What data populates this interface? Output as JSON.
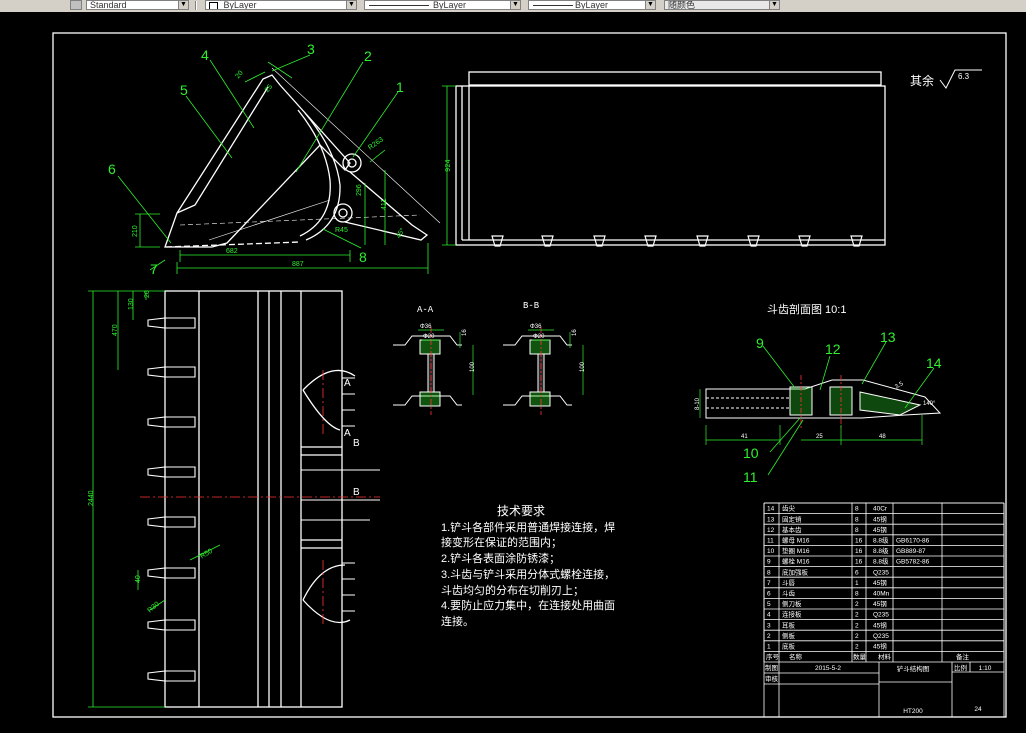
{
  "toolbar": {
    "textstyle": "Standard",
    "layer": "ByLayer",
    "linetype": "ByLayer",
    "lineweight": "ByLayer",
    "plotstyle": "随颜色"
  },
  "drawing": {
    "roughness_prefix": "其余",
    "roughness_value": "6.3",
    "section_detail_title": "斗齿剖面图 10:1",
    "section_aa": "A-A",
    "section_bb": "B-B",
    "leaders": [
      "1",
      "2",
      "3",
      "4",
      "5",
      "6",
      "7",
      "8",
      "9",
      "10",
      "11",
      "12",
      "13",
      "14"
    ],
    "dims_side": {
      "d1": "887",
      "d2": "682",
      "d3": "210",
      "d4": "924",
      "d5": "411",
      "d6": "296",
      "d7": "R45",
      "d8": "R263",
      "d9": "20",
      "d10": "45°",
      "d11": "25"
    },
    "dims_plan": {
      "overall": "2440",
      "a": "470",
      "b": "130",
      "c": "20",
      "d": "40",
      "e": "R50",
      "f": "R30"
    },
    "dims_section": {
      "a": "Φ36",
      "b": "Φ20",
      "c": "16",
      "d": "100"
    },
    "dims_tooth": {
      "a": "41",
      "b": "25",
      "c": "48",
      "d": "8-10",
      "e": "140°",
      "f": "3.5"
    },
    "section_arrows": [
      "A",
      "A",
      "B",
      "B"
    ]
  },
  "tech": {
    "title": "技术要求",
    "lines": [
      "1.铲斗各部件采用普通焊接连接，焊",
      "接变形在保证的范围内；",
      "2.铲斗各表面涂防锈漆；",
      "3.斗齿与铲斗采用分体式螺栓连接，",
      "斗齿均匀的分布在切削刃上；",
      "4.要防止应力集中，在连接处用曲面",
      "连接。"
    ]
  },
  "bom": {
    "rows": [
      [
        "14",
        "齿尖",
        "8",
        "40Cr",
        ""
      ],
      [
        "13",
        "固定销",
        "8",
        "45钢",
        ""
      ],
      [
        "12",
        "基本齿",
        "8",
        "45钢",
        ""
      ],
      [
        "11",
        "螺母 M16",
        "16",
        "8.8级",
        "GB6170-86"
      ],
      [
        "10",
        "垫圈 M16",
        "16",
        "8.8级",
        "GB889-87"
      ],
      [
        "9",
        "螺栓 M16",
        "16",
        "8.8级",
        "GB5782-86"
      ],
      [
        "8",
        "底加强板",
        "6",
        "Q235",
        ""
      ],
      [
        "7",
        "斗唇",
        "1",
        "45钢",
        ""
      ],
      [
        "6",
        "斗齿",
        "8",
        "40Mn",
        ""
      ],
      [
        "5",
        "侧刀板",
        "2",
        "45钢",
        ""
      ],
      [
        "4",
        "连接板",
        "2",
        "Q235",
        ""
      ],
      [
        "3",
        "耳板",
        "2",
        "45钢",
        ""
      ],
      [
        "2",
        "侧板",
        "2",
        "Q235",
        ""
      ],
      [
        "1",
        "底板",
        "2",
        "45钢",
        ""
      ]
    ],
    "header": [
      "序号",
      "名称",
      "数量",
      "材料",
      "备注"
    ],
    "title": "铲斗结构图",
    "date": "2015-5-2",
    "scale_label": "比例",
    "scale": "1:10",
    "drawn_label": "制图",
    "check_label": "审核",
    "material": "HT200",
    "sheet": "24"
  }
}
